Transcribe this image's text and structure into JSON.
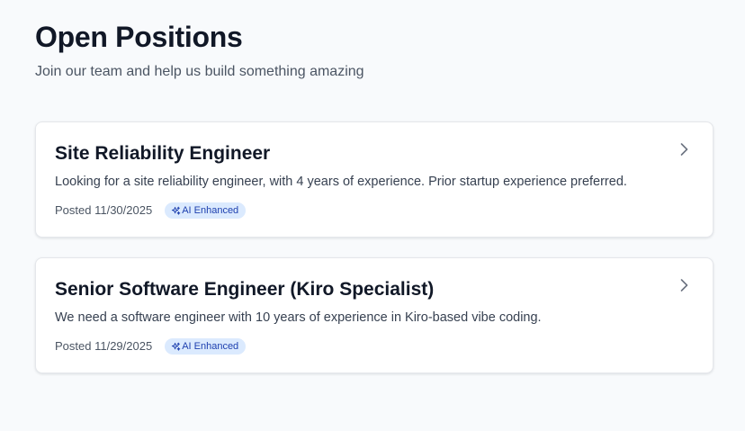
{
  "header": {
    "title": "Open Positions",
    "subtitle": "Join our team and help us build something amazing"
  },
  "jobs": [
    {
      "title": "Site Reliability Engineer",
      "description": "Looking for a site reliability engineer, with 4 years of experience. Prior startup experience preferred.",
      "posted": "Posted 11/30/2025",
      "badge": "AI Enhanced",
      "badge_icon": "sparkles-icon",
      "action_icon": "chevron-right-icon"
    },
    {
      "title": "Senior Software Engineer (Kiro Specialist)",
      "description": "We need a software engineer with 10 years of experience in Kiro-based vibe coding.",
      "posted": "Posted 11/29/2025",
      "badge": "AI Enhanced",
      "badge_icon": "sparkles-icon",
      "action_icon": "chevron-right-icon"
    }
  ],
  "colors": {
    "background": "#f8fafc",
    "card": "#ffffff",
    "badge_background": "#dbeafe",
    "badge_text": "#1e40af",
    "title_text": "#111827",
    "muted_text": "#4b5563"
  }
}
